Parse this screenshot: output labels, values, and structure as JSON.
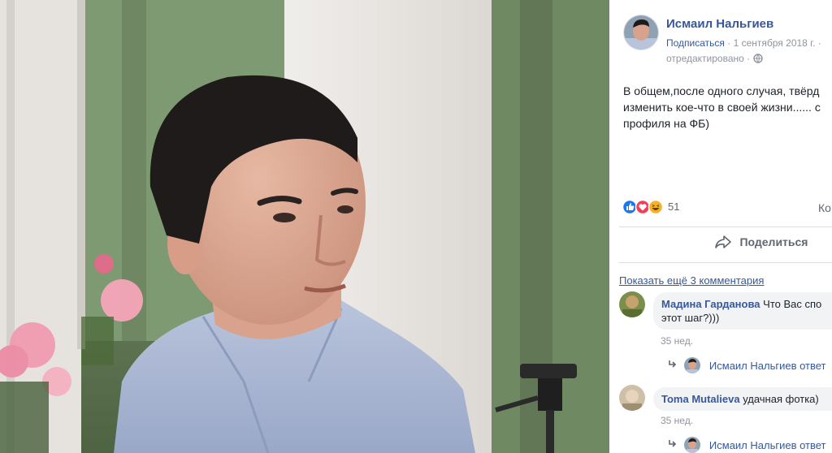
{
  "post": {
    "author": "Исмаил Нальгиев",
    "subscribe": "Подписаться",
    "date": "1 сентября 2018 г.",
    "dot": "·",
    "edited": "отредактировано",
    "text_lines": [
      "В общем,после одного случая, твёрд",
      "изменить кое-что в своей жизни...... с",
      "профиля на ФБ)"
    ],
    "reaction_count": "51",
    "comments_link_cut": "Ко",
    "share_label": "Поделиться",
    "show_more_comments": "Показать ещё 3 комментария"
  },
  "comments": [
    {
      "name": "Мадина Гарданова",
      "text_line1": "Что Вас спо",
      "text_line2": "этот шаг?)))",
      "time": "35 нед.",
      "reply_name": "Исмаил Нальгиев ответ"
    },
    {
      "name": "Toma Mutalieva",
      "text_line1": "удачная фотка)",
      "time": "35 нед.",
      "reply_name": "Исмаил Нальгиев ответ"
    }
  ],
  "colors": {
    "link": "#365899",
    "like": "#1877f2",
    "love": "#f33e58",
    "haha": "#f7b125"
  }
}
